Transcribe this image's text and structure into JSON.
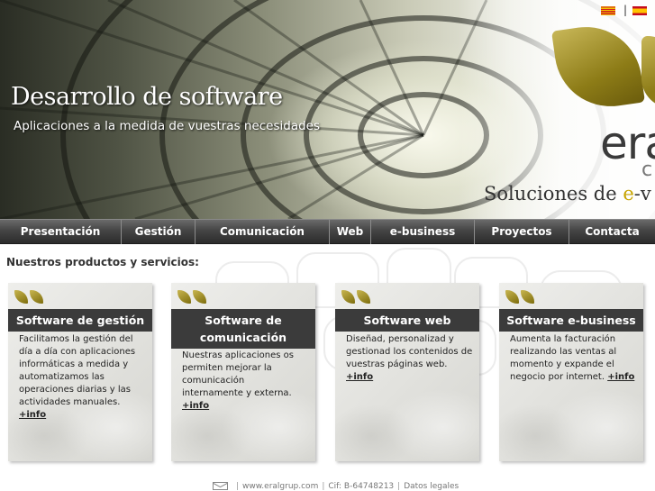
{
  "hero": {
    "title": "Desarrollo de software",
    "subtitle": "Aplicaciones a la medida de vuestras necesidades",
    "brand_text": "eral",
    "brand_tail": "c",
    "tagline_before": "Soluciones de ",
    "tagline_accent": "e",
    "tagline_after": "-v",
    "languages": [
      "catalan-flag-icon",
      "spain-flag-icon"
    ],
    "language_separator": "|"
  },
  "nav": {
    "items": [
      "Presentación",
      "Gestión",
      "Comunicación",
      "Web",
      "e-business",
      "Proyectos",
      "Contacta"
    ]
  },
  "section_title": "Nuestros productos y servicios:",
  "cards": [
    {
      "title": "Software de gestión",
      "text": "Facilitamos la gestión del día a día con aplicaciones informáticas a medida y automatizamos las operaciones diarias y las actividades manuales.",
      "more": "+info"
    },
    {
      "title": "Software de comunicación",
      "text": "Nuestras aplicaciones os permiten mejorar la comunicación internamente y externa.",
      "more": "+info"
    },
    {
      "title": "Software web",
      "text": "Diseñad, personalizad y gestionad los contenidos de vuestras páginas web.",
      "more": "+info"
    },
    {
      "title": "Software e-business",
      "text": "Aumenta la facturación realizando las ventas al momento y expande el negocio por internet.",
      "more": "+info"
    }
  ],
  "footer": {
    "separator": "|",
    "website": "www.eralgrup.com",
    "cif": "Cif: B-64748213",
    "legal": "Datos legales"
  },
  "colors": {
    "nav_bg": "#3a3a3a",
    "card_header": "#3b3b3b",
    "brand_olive": "#8d7c17",
    "accent_yellow": "#c7a400"
  }
}
